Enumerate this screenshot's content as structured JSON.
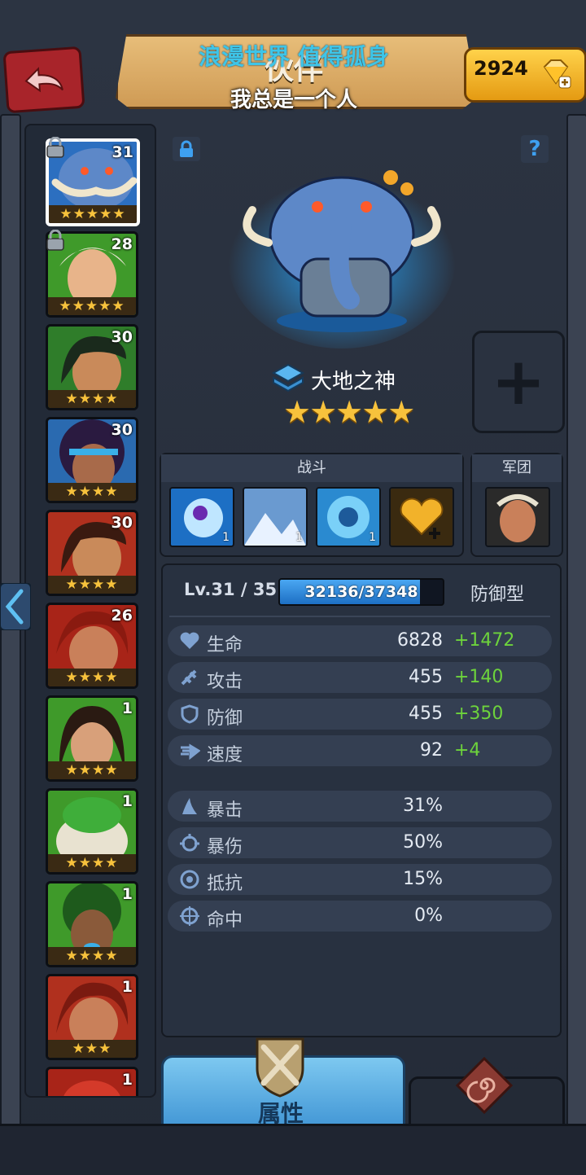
{
  "header": {
    "title": "伙伴",
    "overlay_top": "浪漫世界 值得孤身",
    "overlay_bottom": "我总是一个人",
    "gems": "2924"
  },
  "hero_list": [
    {
      "level": "31",
      "stars": "★★★★★",
      "locked": true
    },
    {
      "level": "28",
      "stars": "★★★★★",
      "locked": true
    },
    {
      "level": "30",
      "stars": "★★★★",
      "locked": false
    },
    {
      "level": "30",
      "stars": "★★★★",
      "locked": false
    },
    {
      "level": "30",
      "stars": "★★★★",
      "locked": false
    },
    {
      "level": "26",
      "stars": "★★★★",
      "locked": false
    },
    {
      "level": "1",
      "stars": "★★★★",
      "locked": false
    },
    {
      "level": "1",
      "stars": "★★★★",
      "locked": false
    },
    {
      "level": "1",
      "stars": "★★★★",
      "locked": false
    },
    {
      "level": "1",
      "stars": "★★★",
      "locked": false
    },
    {
      "level": "1",
      "stars": "",
      "locked": false
    }
  ],
  "hero": {
    "name": "大地之神",
    "stars": "★★★★★",
    "level_text": "Lv.31 / 35",
    "xp_text": "32136/37348",
    "xp_fraction": 0.86,
    "role": "防御型"
  },
  "sections": {
    "combat": "战斗",
    "legion": "军团",
    "skill_levels": [
      "1",
      "1",
      "1",
      ""
    ]
  },
  "stats": [
    {
      "icon": "heart-icon",
      "label": "生命",
      "value": "6828",
      "bonus": "+1472"
    },
    {
      "icon": "attack-icon",
      "label": "攻击",
      "value": "455",
      "bonus": "+140"
    },
    {
      "icon": "shield-icon",
      "label": "防御",
      "value": "455",
      "bonus": "+350"
    },
    {
      "icon": "speed-icon",
      "label": "速度",
      "value": "92",
      "bonus": "+4"
    }
  ],
  "sub_stats": [
    {
      "icon": "crit-icon",
      "label": "暴击",
      "value": "31%"
    },
    {
      "icon": "crit-damage-icon",
      "label": "暴伤",
      "value": "50%"
    },
    {
      "icon": "resist-icon",
      "label": "抵抗",
      "value": "15%"
    },
    {
      "icon": "accuracy-icon",
      "label": "命中",
      "value": "0%"
    }
  ],
  "tabs": {
    "attributes": "属性"
  },
  "colors": {
    "bonus": "#6dd33c",
    "star": "#f7c23c",
    "accent_blue": "#3f94d4",
    "overlay_cyan": "#3ec5e8"
  }
}
